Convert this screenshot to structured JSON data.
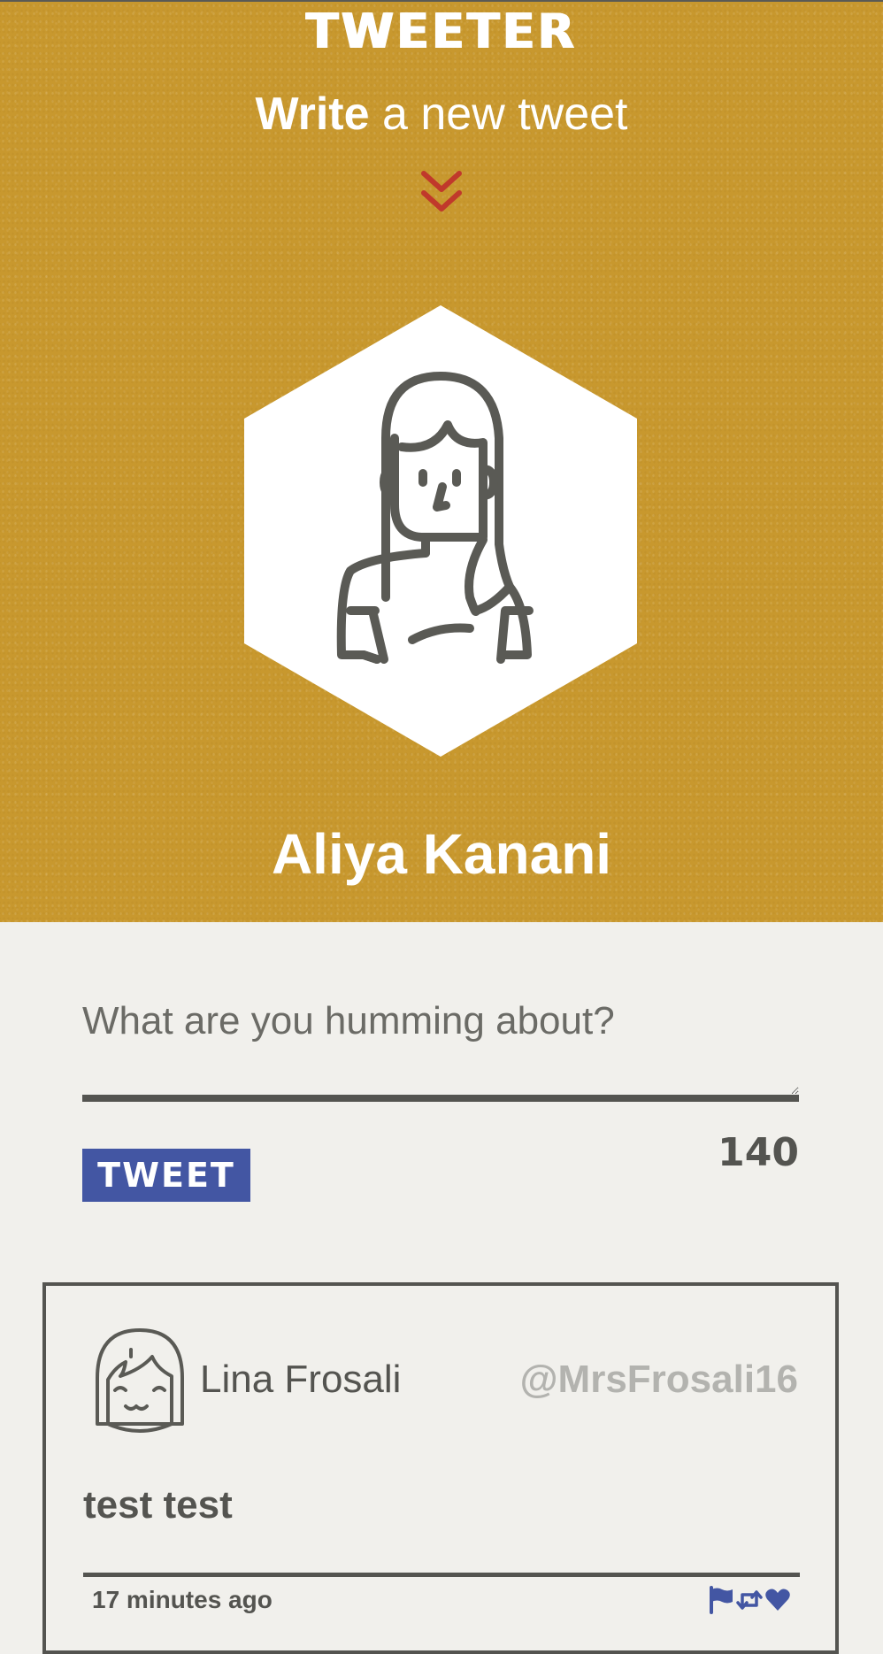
{
  "app": {
    "brand": "TWEETER",
    "compose_toggle": {
      "bold": "Write",
      "rest": " a new tweet"
    },
    "colors": {
      "header_bg": "#c8982e",
      "accent_red": "#c0392b",
      "button_blue": "#4356a3",
      "text_dark": "#545450",
      "page_bg": "#f1f0ec"
    }
  },
  "profile": {
    "name": "Aliya Kanani",
    "avatar_icon": "woman-avatar-icon"
  },
  "compose": {
    "placeholder": "What are you humming about?",
    "value": "",
    "button_label": "TWEET",
    "char_count": "140"
  },
  "tweets": [
    {
      "author": "Lina Frosali",
      "handle": "@MrsFrosali16",
      "text": "test test",
      "time": "17 minutes ago",
      "avatar_icon": "girl-avatar-icon",
      "actions": [
        "flag-icon",
        "retweet-icon",
        "heart-icon"
      ]
    }
  ]
}
